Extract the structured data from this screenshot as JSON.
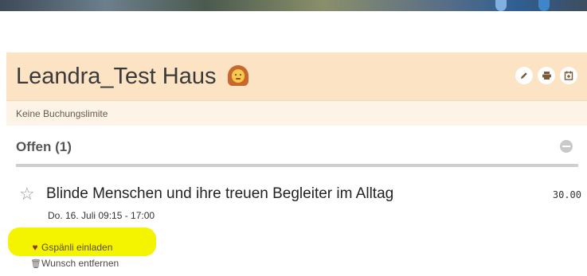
{
  "header": {
    "title": "Leandra_Test Haus",
    "icons": [
      "pencil-icon",
      "print-icon",
      "calendar-icon"
    ]
  },
  "limit_text": "Keine Buchungslimite",
  "section": {
    "title": "Offen (1)"
  },
  "event": {
    "title": "Blinde Menschen und ihre treuen Begleiter im Alltag",
    "date": "Do. 16. Juli 09:15 - 17:00",
    "price": "30.00"
  },
  "actions": {
    "invite_label": "Gspänli einladen",
    "remove_label": "Wunsch entfernen"
  },
  "colors": {
    "header_bg": "#fbe3c4",
    "limit_bg": "#fdf3e6",
    "highlight": "#f5f400"
  }
}
